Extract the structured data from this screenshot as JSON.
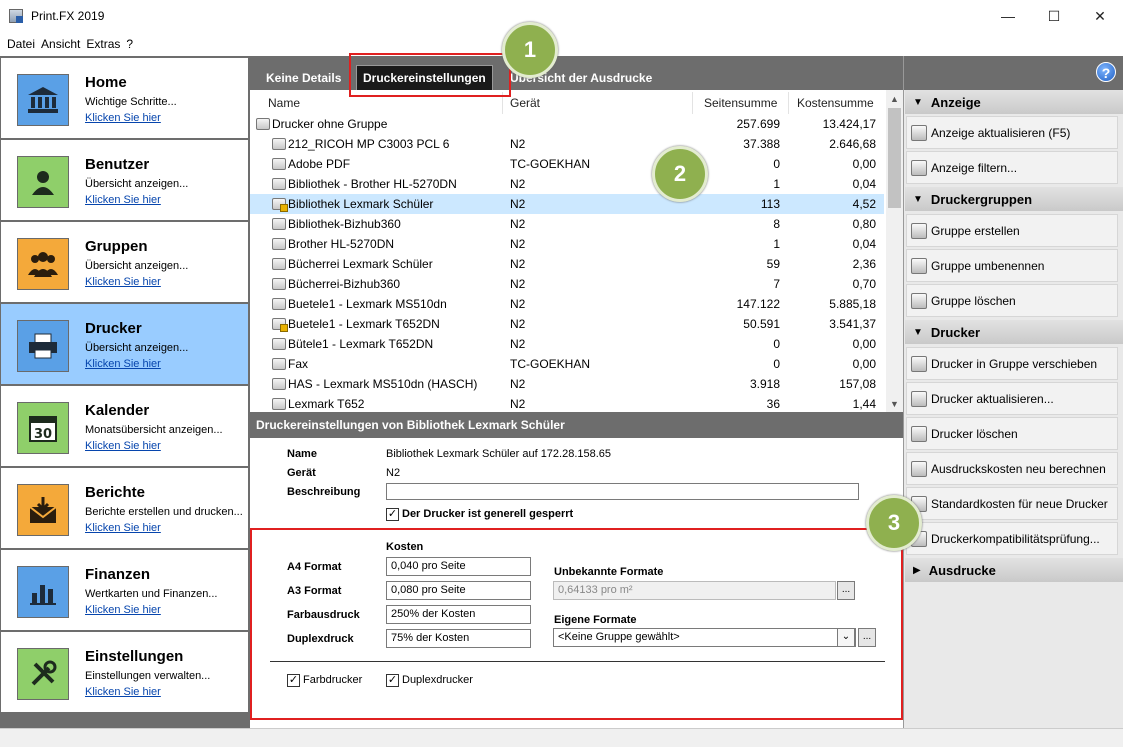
{
  "window": {
    "title": "Print.FX 2019",
    "min": "—",
    "max": "☐",
    "close": "✕"
  },
  "menu": [
    "Datei",
    "Ansicht",
    "Extras",
    "?"
  ],
  "nav": [
    {
      "title": "Home",
      "sub": "Wichtige Schritte...",
      "link": "Klicken Sie hier",
      "icon": "bank-icon",
      "color": "#5aa0e6"
    },
    {
      "title": "Benutzer",
      "sub": "Übersicht anzeigen...",
      "link": "Klicken Sie hier",
      "icon": "user-icon",
      "color": "#8fcf6a"
    },
    {
      "title": "Gruppen",
      "sub": "Übersicht anzeigen...",
      "link": "Klicken Sie hier",
      "icon": "group-icon",
      "color": "#f4a93a"
    },
    {
      "title": "Drucker",
      "sub": "Übersicht anzeigen...",
      "link": "Klicken Sie hier",
      "icon": "printer-icon",
      "color": "#5aa0e6"
    },
    {
      "title": "Kalender",
      "sub": "Monatsübersicht anzeigen...",
      "link": "Klicken Sie hier",
      "icon": "calendar-icon",
      "color": "#8fcf6a"
    },
    {
      "title": "Berichte",
      "sub": "Berichte erstellen und drucken...",
      "link": "Klicken Sie hier",
      "icon": "report-icon",
      "color": "#f4a93a"
    },
    {
      "title": "Finanzen",
      "sub": "Wertkarten und Finanzen...",
      "link": "Klicken Sie hier",
      "icon": "finance-icon",
      "color": "#5aa0e6"
    },
    {
      "title": "Einstellungen",
      "sub": "Einstellungen verwalten...",
      "link": "Klicken Sie hier",
      "icon": "tools-icon",
      "color": "#8fcf6a"
    }
  ],
  "calendar_day": "30",
  "tabs": [
    "Keine Details",
    "Druckereinstellungen",
    "Übersicht der Ausdrucke"
  ],
  "columns": {
    "name": "Name",
    "device": "Gerät",
    "pages": "Seitensumme",
    "cost": "Kostensumme"
  },
  "rows": [
    {
      "name": "Drucker ohne Gruppe",
      "device": "",
      "pages": "257.699",
      "cost": "13.424,17"
    },
    {
      "name": "212_RICOH MP C3003 PCL 6",
      "device": "N2",
      "pages": "37.388",
      "cost": "2.646,68"
    },
    {
      "name": "Adobe PDF",
      "device": "TC-GOEKHAN",
      "pages": "0",
      "cost": "0,00"
    },
    {
      "name": "Bibliothek - Brother HL-5270DN",
      "device": "N2",
      "pages": "1",
      "cost": "0,04"
    },
    {
      "name": "Bibliothek Lexmark Schüler",
      "device": "N2",
      "pages": "113",
      "cost": "4,52"
    },
    {
      "name": "Bibliothek-Bizhub360",
      "device": "N2",
      "pages": "8",
      "cost": "0,80"
    },
    {
      "name": "Brother HL-5270DN",
      "device": "N2",
      "pages": "1",
      "cost": "0,04"
    },
    {
      "name": "Bücherrei Lexmark Schüler",
      "device": "N2",
      "pages": "59",
      "cost": "2,36"
    },
    {
      "name": "Bücherrei-Bizhub360",
      "device": "N2",
      "pages": "7",
      "cost": "0,70"
    },
    {
      "name": "Buetele1 - Lexmark MS510dn",
      "device": "N2",
      "pages": "147.122",
      "cost": "5.885,18"
    },
    {
      "name": "Buetele1 - Lexmark T652DN",
      "device": "N2",
      "pages": "50.591",
      "cost": "3.541,37"
    },
    {
      "name": "Bütele1 - Lexmark T652DN",
      "device": "N2",
      "pages": "0",
      "cost": "0,00"
    },
    {
      "name": "Fax",
      "device": "TC-GOEKHAN",
      "pages": "0",
      "cost": "0,00"
    },
    {
      "name": "HAS - Lexmark MS510dn (HASCH)",
      "device": "N2",
      "pages": "3.918",
      "cost": "157,08"
    },
    {
      "name": "Lexmark T652",
      "device": "N2",
      "pages": "36",
      "cost": "1,44"
    }
  ],
  "detail": {
    "header": "Druckereinstellungen von Bibliothek Lexmark Schüler",
    "name_label": "Name",
    "name_value": "Bibliothek Lexmark Schüler auf 172.28.158.65",
    "device_label": "Gerät",
    "device_value": "N2",
    "desc_label": "Beschreibung",
    "desc_value": "",
    "locked_label": "Der Drucker ist generell gesperrt",
    "kosten_label": "Kosten",
    "a4_label": "A4 Format",
    "a4_value": "0,040 pro Seite",
    "a3_label": "A3 Format",
    "a3_value": "0,080 pro Seite",
    "color_label": "Farbausdruck",
    "color_value": "250% der Kosten",
    "duplex_label": "Duplexdruck",
    "duplex_value": "75% der Kosten",
    "unknown_label": "Unbekannte Formate",
    "unknown_value": "0,64133 pro m²",
    "own_label": "Eigene Formate",
    "own_value": "<Keine Gruppe gewählt>",
    "browse": "...",
    "colorprinter_label": "Farbdrucker",
    "duplexprinter_label": "Duplexdrucker"
  },
  "sidebar": {
    "help": "?",
    "sections": [
      {
        "title": "Anzeige",
        "items": [
          "Anzeige aktualisieren (F5)",
          "Anzeige filtern..."
        ]
      },
      {
        "title": "Druckergruppen",
        "items": [
          "Gruppe erstellen",
          "Gruppe umbenennen",
          "Gruppe löschen"
        ]
      },
      {
        "title": "Drucker",
        "items": [
          "Drucker in Gruppe verschieben",
          "Drucker aktualisieren...",
          "Drucker löschen",
          "Ausdruckskosten neu berechnen",
          "Standardkosten für neue Drucker",
          "Druckerkompatibilitätsprüfung..."
        ]
      },
      {
        "title": "Ausdrucke",
        "items": []
      }
    ]
  },
  "callouts": [
    "1",
    "2",
    "3"
  ],
  "colors": {
    "panel_gray": "#6d6d6d",
    "selection": "#cce8ff",
    "active_nav": "#99ccff",
    "callout": "#8fb04f",
    "highlight": "#e02020"
  }
}
